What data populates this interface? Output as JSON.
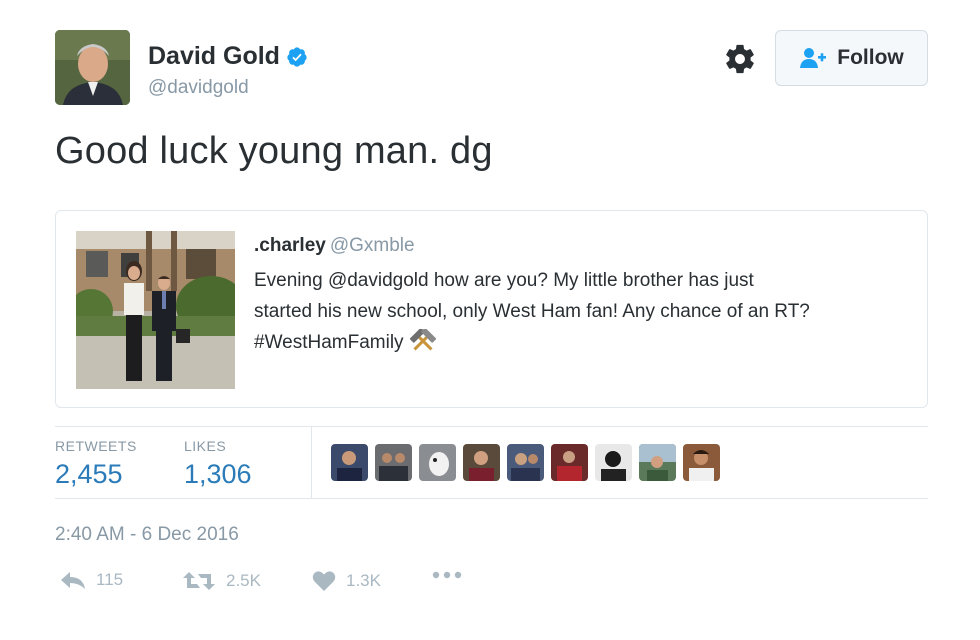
{
  "author": {
    "name": "David Gold",
    "handle": "@davidgold",
    "verified": true,
    "avatar": "person-avatar"
  },
  "header": {
    "settings_icon": "gear-icon",
    "follow_label": "Follow",
    "follow_icon": "user-plus-icon"
  },
  "tweet": {
    "text": "Good luck young man. dg"
  },
  "quoted_tweet": {
    "name": ".charley",
    "handle": "@Gxmble",
    "lines": [
      "Evening @davidgold how are you? My little brother has just",
      "started his new school, only West Ham fan! Any chance of an RT?",
      "#WestHamFamily"
    ],
    "emoji": "hammers-icon",
    "photo": "photo-two-people-outside-house"
  },
  "stats": {
    "retweets_label": "RETWEETS",
    "retweets_value": "2,455",
    "likes_label": "LIKES",
    "likes_value": "1,306"
  },
  "likers_count_shown": 9,
  "timestamp": "2:40 AM - 6 Dec 2016",
  "actions": {
    "reply_count": "115",
    "retweet_count": "2.5K",
    "like_count": "1.3K",
    "more_icon": "more-dots-icon"
  },
  "colors": {
    "link_blue": "#2b7bb9",
    "muted_gray": "#8899a6",
    "action_gray": "#aab8c2",
    "verified_blue": "#1da1f2",
    "text": "#292f33",
    "border": "#e1e8ed"
  }
}
